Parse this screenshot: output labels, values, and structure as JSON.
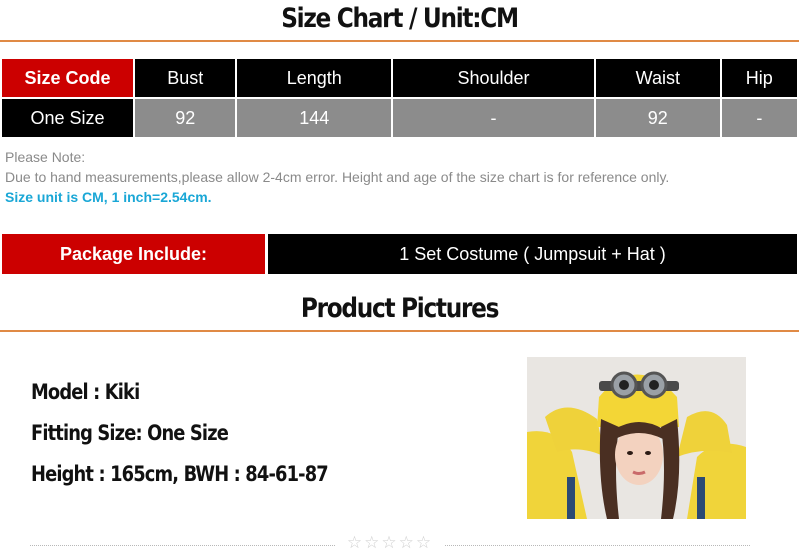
{
  "size_chart": {
    "title": "Size Chart / Unit:CM",
    "header": [
      "Size Code",
      "Bust",
      "Length",
      "Shoulder",
      "Waist",
      "Hip"
    ],
    "row": [
      "One Size",
      "92",
      "144",
      "-",
      "92",
      "-"
    ]
  },
  "note": {
    "label": "Please Note:",
    "text": "Due to hand measurements,please allow 2-4cm error. Height and age of the size chart is for reference only.",
    "unit": "Size unit is CM, 1 inch=2.54cm."
  },
  "package": {
    "label": "Package Include:",
    "value": "1 Set Costume ( Jumpsuit + Hat )"
  },
  "product": {
    "title": "Product Pictures",
    "model": "Model : Kiki",
    "fitting": "Fitting Size: One Size",
    "height": "Height : 165cm, BWH : 84-61-87"
  },
  "rating": {
    "stars": "☆☆☆☆☆"
  },
  "colors": {
    "accent_red": "#cc0000",
    "rule_orange": "#e08a45",
    "note_blue": "#1aa7d6",
    "cell_gray": "#8c8c8c"
  }
}
